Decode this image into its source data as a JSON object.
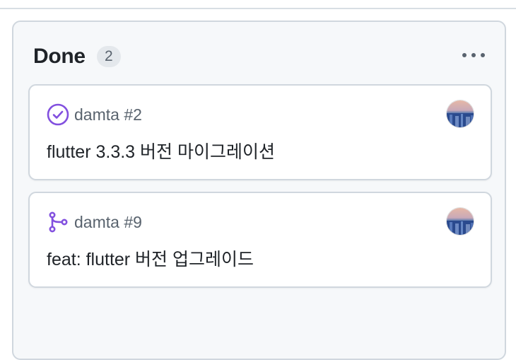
{
  "column": {
    "title": "Done",
    "count": "2",
    "menu_icon": "kebab-horizontal-icon"
  },
  "cards": [
    {
      "state_icon": "check-circle-icon",
      "repo": "damta",
      "number": "#2",
      "ref": "damta #2",
      "title": "flutter 3.3.3 버전 마이그레이션",
      "avatar_icon": "user-avatar"
    },
    {
      "state_icon": "git-branch-icon",
      "repo": "damta",
      "number": "#9",
      "ref": "damta #9",
      "title": "feat: flutter 버전 업그레이드",
      "avatar_icon": "user-avatar"
    }
  ],
  "colors": {
    "accent_purple": "#8250df",
    "column_bg": "#f6f8fa",
    "border": "#d0d7de",
    "text_muted": "#59636e"
  }
}
